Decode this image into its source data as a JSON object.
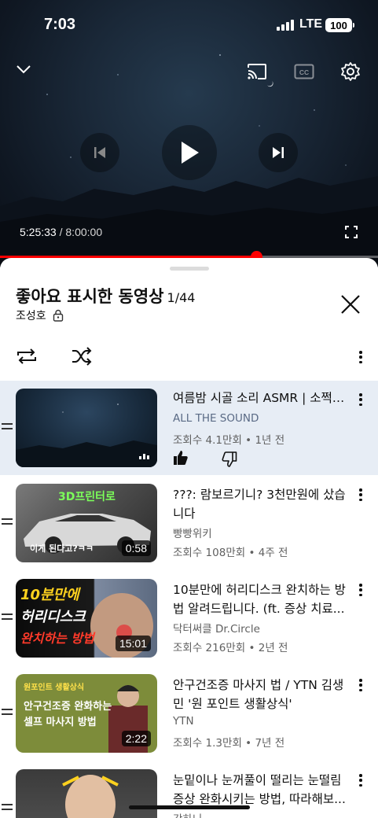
{
  "status": {
    "time": "7:03",
    "network": "LTE",
    "battery": "100"
  },
  "player": {
    "current_time": "5:25:33",
    "separator": " / ",
    "duration": "8:00:00",
    "progress_fraction": 0.678
  },
  "playlist": {
    "title": "좋아요 표시한 동영상",
    "position": "1/44",
    "owner": "조성호"
  },
  "videos": [
    {
      "title": "여름밤 시골 소리 ASMR | 소쩍새 소리",
      "channel": "ALL THE SOUND",
      "views": "조회수 4.1만회",
      "age": "1년 전"
    },
    {
      "title": "???: 람보르기니? 3천만원에 샀습니다",
      "channel": "빵빵위키",
      "views": "조회수 108만회",
      "age": "4주 전",
      "duration": "0:58",
      "thumb_text_top": "3D프린터로",
      "thumb_text_bottom": "이게 된다고?ㅋㅋ"
    },
    {
      "title": "10분만에 허리디스크 완치하는 방법 알려드립니다. (ft. 증상 치료...",
      "channel": "닥터써클 Dr.Circle",
      "views": "조회수 216만회",
      "age": "2년 전",
      "duration": "15:01",
      "thumb_text_1": "10분만에",
      "thumb_text_2": "허리디스크",
      "thumb_text_3": "완치하는 방법"
    },
    {
      "title": "안구건조증 마사지 법 / YTN 김생민 '원 포인트 생활상식'",
      "channel": "YTN",
      "views": "조회수 1.3만회",
      "age": "7년 전",
      "duration": "2:22",
      "thumb_text_1": "원포인트 생활상식",
      "thumb_text_2": "안구건조증 완화하는",
      "thumb_text_3": "셀프 마사지 방법"
    },
    {
      "title": "눈밑이나 눈꺼풀이 떨리는 눈떨림 증상 완화시키는 방법, 따라해보...",
      "channel": "강하니",
      "views": "",
      "age": ""
    }
  ],
  "meta_separator": "•",
  "colors": {
    "accent": "#ff0000",
    "active_row": "#e7edf5"
  }
}
